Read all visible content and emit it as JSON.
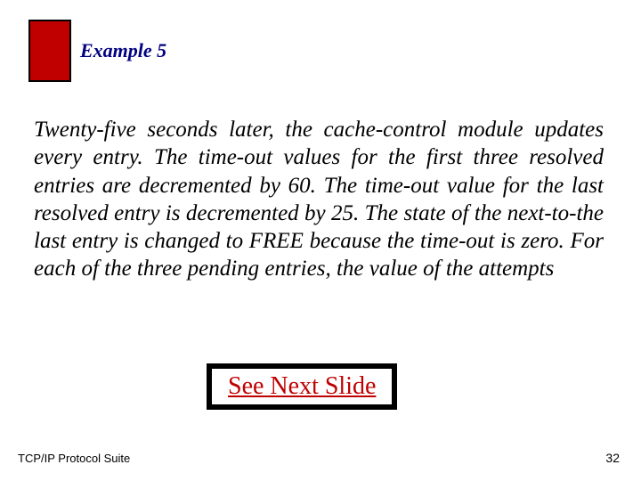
{
  "header": {
    "example_label": "Example 5"
  },
  "body": {
    "paragraph": "Twenty-five seconds later, the cache-control module updates every entry. The time-out values for the first three resolved entries are decremented by 60. The time-out value for the last resolved entry is decremented by 25. The state of the next-to-the last entry is changed to FREE because the time-out is zero. For each of the three pending entries, the value of the attempts"
  },
  "link": {
    "next_slide": "See Next Slide"
  },
  "footer": {
    "left": "TCP/IP Protocol Suite",
    "page_number": "32"
  }
}
